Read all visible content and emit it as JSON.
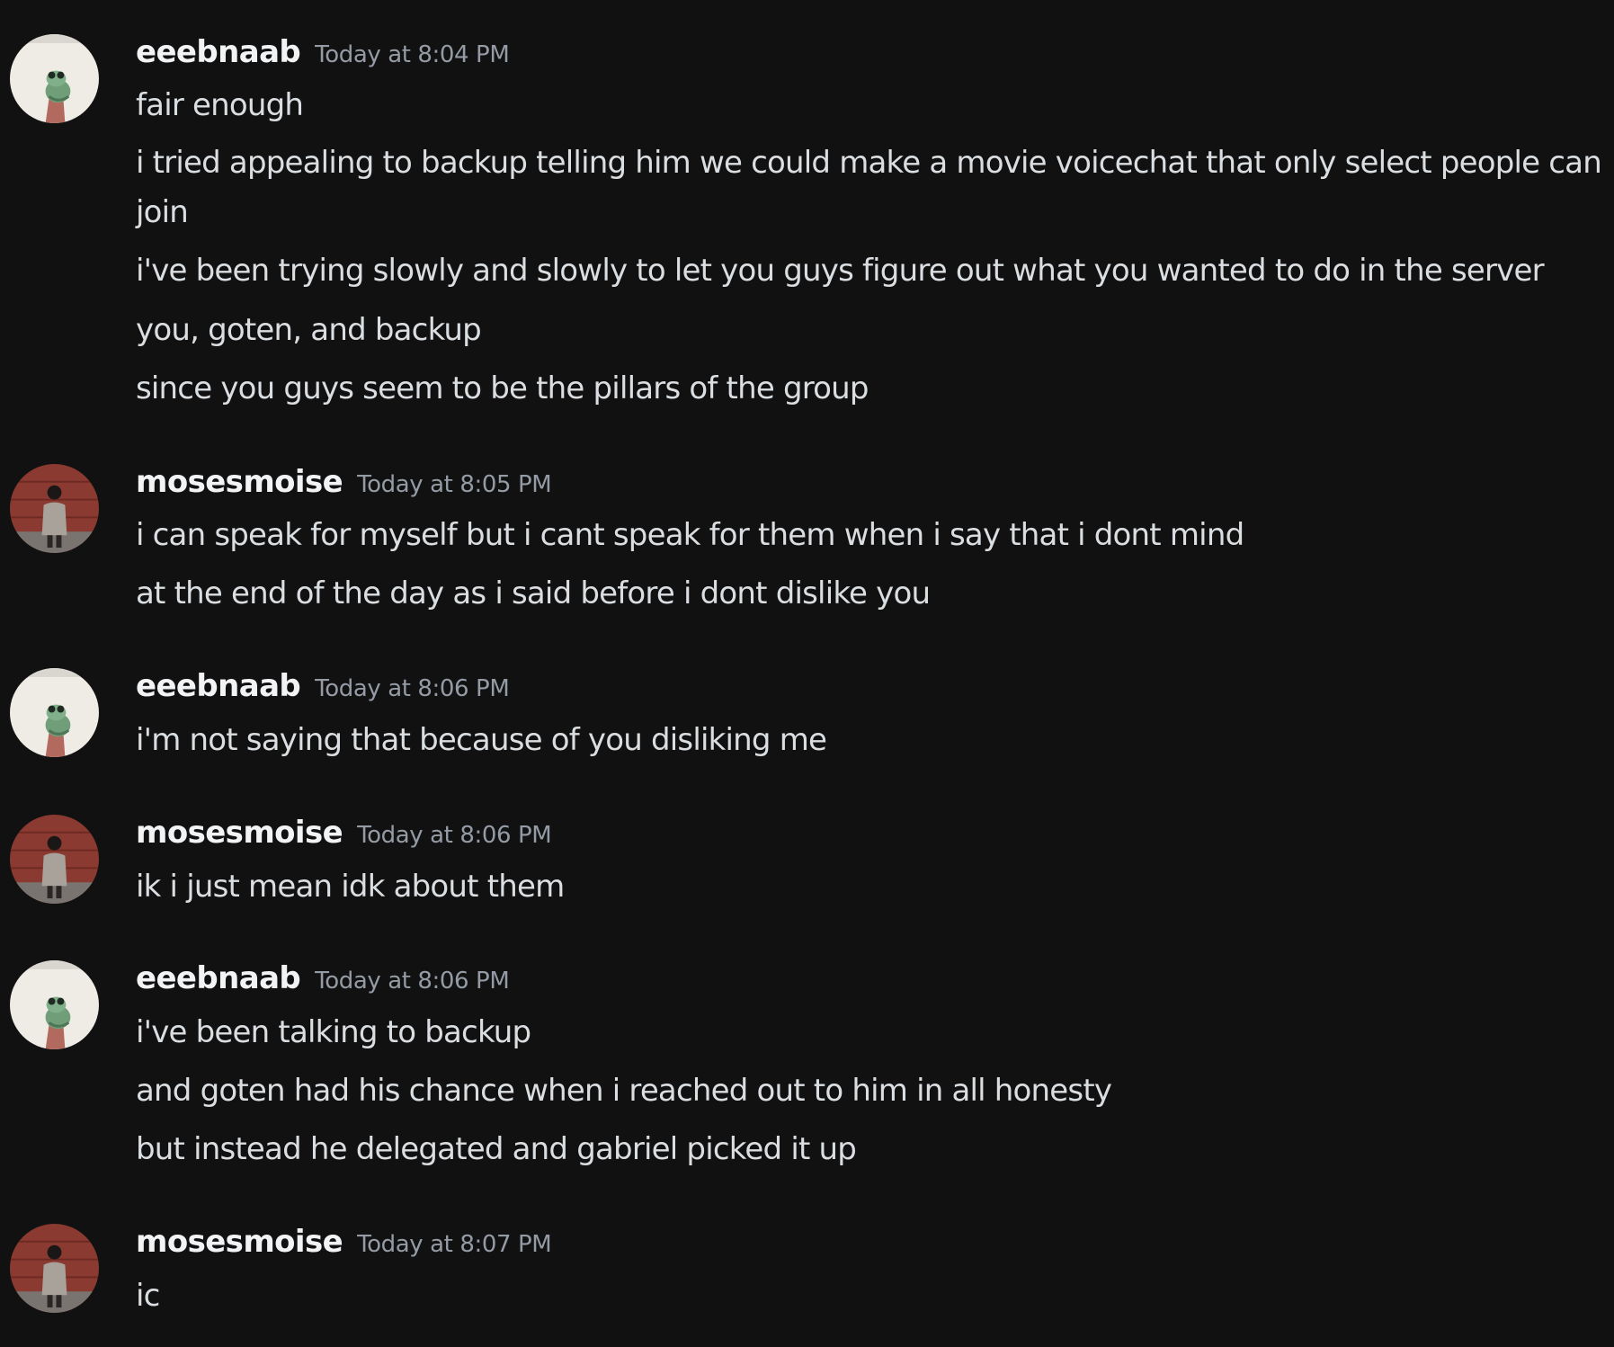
{
  "messages": [
    {
      "author": "eeebnaab",
      "avatar": "frog-avatar-icon",
      "timestamp": "Today at 8:04 PM",
      "lines": [
        "fair enough",
        "i tried appealing to backup telling him we could make a movie voicechat that only select people can join",
        "i've been trying slowly and slowly to let you guys figure out what you wanted to do in the server",
        "you, goten, and backup",
        "since you guys seem to be the pillars of the group"
      ]
    },
    {
      "author": "mosesmoise",
      "avatar": "person-avatar-icon",
      "timestamp": "Today at 8:05 PM",
      "lines": [
        "i can speak for myself but i cant speak for them when i say that i dont mind",
        "at the end of the day as i said before i dont dislike you"
      ]
    },
    {
      "author": "eeebnaab",
      "avatar": "frog-avatar-icon",
      "timestamp": "Today at 8:06 PM",
      "lines": [
        "i'm not saying that because of you disliking me"
      ]
    },
    {
      "author": "mosesmoise",
      "avatar": "person-avatar-icon",
      "timestamp": "Today at 8:06 PM",
      "lines": [
        "ik i just mean idk about them"
      ]
    },
    {
      "author": "eeebnaab",
      "avatar": "frog-avatar-icon",
      "timestamp": "Today at 8:06 PM",
      "lines": [
        "i've been talking to backup",
        "and goten had his chance when i reached out to him in all honesty",
        "but instead he delegated and gabriel picked it up"
      ]
    },
    {
      "author": "mosesmoise",
      "avatar": "person-avatar-icon",
      "timestamp": "Today at 8:07 PM",
      "lines": [
        "ic"
      ]
    }
  ],
  "colors": {
    "background": "#111112",
    "username": "#f2f3f5",
    "timestamp": "#949ba4",
    "message_text": "#dbdee1"
  }
}
